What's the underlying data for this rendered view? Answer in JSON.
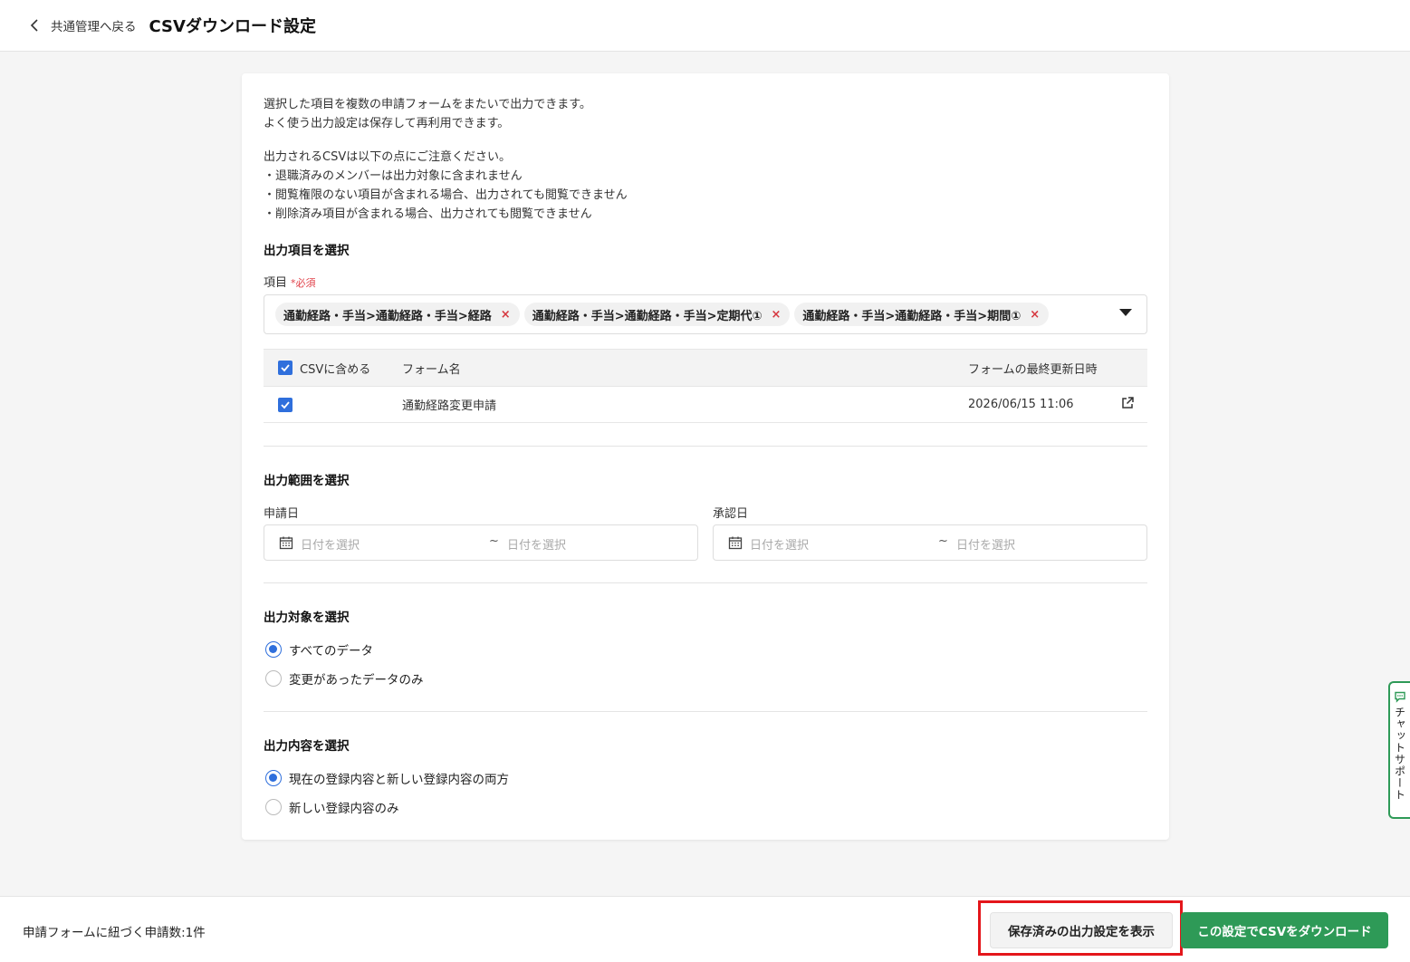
{
  "header": {
    "back_label": "共通管理へ戻る",
    "title": "CSVダウンロード設定"
  },
  "description": {
    "lines1": [
      "選択した項目を複数の申請フォームをまたいで出力できます。",
      "よく使う出力設定は保存して再利用できます。"
    ],
    "lines2": [
      "出力されるCSVは以下の点にご注意ください。",
      "・退職済みのメンバーは出力対象に含まれません",
      "・閲覧権限のない項目が含まれる場合、出力されても閲覧できません",
      "・削除済み項目が含まれる場合、出力されても閲覧できません"
    ]
  },
  "items_section": {
    "title": "出力項目を選択",
    "field_label": "項目",
    "required": "*必須",
    "chips": [
      "通勤経路・手当>通勤経路・手当>経路",
      "通勤経路・手当>通勤経路・手当>定期代①",
      "通勤経路・手当>通勤経路・手当>期間①"
    ],
    "chip_remove": "×"
  },
  "table": {
    "headers": {
      "include": "CSVに含める",
      "form_name": "フォーム名",
      "updated": "フォームの最終更新日時"
    },
    "rows": [
      {
        "form_name": "通勤経路変更申請",
        "updated": "2026/06/15 11:06",
        "checked": true
      }
    ]
  },
  "range_section": {
    "title": "出力範囲を選択",
    "apply_label": "申請日",
    "approve_label": "承認日",
    "date_placeholder": "日付を選択",
    "tilde": "~"
  },
  "target_section": {
    "title": "出力対象を選択",
    "options": [
      "すべてのデータ",
      "変更があったデータのみ"
    ],
    "selected": 0
  },
  "content_section": {
    "title": "出力内容を選択",
    "options": [
      "現在の登録内容と新しい登録内容の両方",
      "新しい登録内容のみ"
    ],
    "selected": 0
  },
  "footer": {
    "count_text": "申請フォームに紐づく申請数:1件",
    "saved_button": "保存済みの出力設定を表示",
    "download_button": "この設定でCSVをダウンロード"
  },
  "chat": {
    "label": "チャットサポート"
  },
  "colors": {
    "primary": "#2f6fdc",
    "green": "#2e9a57",
    "highlight": "#e4161b",
    "required": "#e0424a"
  }
}
